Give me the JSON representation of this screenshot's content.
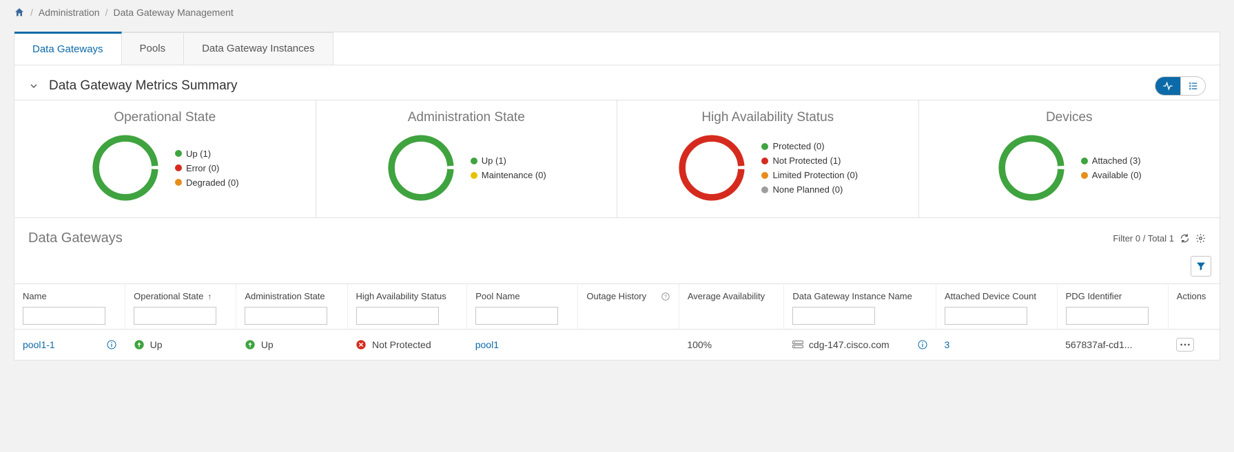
{
  "breadcrumb": {
    "items": [
      "Administration",
      "Data Gateway Management"
    ]
  },
  "tabs": {
    "items": [
      {
        "label": "Data Gateways",
        "active": true
      },
      {
        "label": "Pools",
        "active": false
      },
      {
        "label": "Data Gateway Instances",
        "active": false
      }
    ]
  },
  "summary": {
    "title": "Data Gateway Metrics Summary"
  },
  "chart_data": [
    {
      "type": "pie",
      "title": "Operational State",
      "series": [
        {
          "name": "Up",
          "value": 1,
          "color": "#3fa33f"
        },
        {
          "name": "Error",
          "value": 0,
          "color": "#d52b1e"
        },
        {
          "name": "Degraded",
          "value": 0,
          "color": "#e58e1a"
        }
      ],
      "legend": [
        "Up (1)",
        "Error (0)",
        "Degraded (0)"
      ]
    },
    {
      "type": "pie",
      "title": "Administration State",
      "series": [
        {
          "name": "Up",
          "value": 1,
          "color": "#3fa33f"
        },
        {
          "name": "Maintenance",
          "value": 0,
          "color": "#e6c200"
        }
      ],
      "legend": [
        "Up (1)",
        "Maintenance (0)"
      ]
    },
    {
      "type": "pie",
      "title": "High Availability Status",
      "series": [
        {
          "name": "Protected",
          "value": 0,
          "color": "#3fa33f"
        },
        {
          "name": "Not Protected",
          "value": 1,
          "color": "#d52b1e"
        },
        {
          "name": "Limited Protection",
          "value": 0,
          "color": "#e58e1a"
        },
        {
          "name": "None Planned",
          "value": 0,
          "color": "#9e9e9e"
        }
      ],
      "legend": [
        "Protected (0)",
        "Not Protected (1)",
        "Limited Protection (0)",
        "None Planned (0)"
      ]
    },
    {
      "type": "pie",
      "title": "Devices",
      "series": [
        {
          "name": "Attached",
          "value": 3,
          "color": "#3fa33f"
        },
        {
          "name": "Available",
          "value": 0,
          "color": "#e58e1a"
        }
      ],
      "legend": [
        "Attached (3)",
        "Available (0)"
      ]
    }
  ],
  "table": {
    "title": "Data Gateways",
    "filter_label": "Filter 0 / Total 1",
    "columns": [
      {
        "label": "Name"
      },
      {
        "label": "Operational State",
        "sort": "asc"
      },
      {
        "label": "Administration State"
      },
      {
        "label": "High Availability Status"
      },
      {
        "label": "Pool Name"
      },
      {
        "label": "Outage History",
        "help": true
      },
      {
        "label": "Average Availability"
      },
      {
        "label": "Data Gateway Instance Name"
      },
      {
        "label": "Attached Device Count"
      },
      {
        "label": "PDG Identifier"
      },
      {
        "label": "Actions"
      }
    ],
    "rows": [
      {
        "name": "pool1-1",
        "op_state": "Up",
        "admin_state": "Up",
        "ha_status": "Not Protected",
        "pool_name": "pool1",
        "outage_history": "",
        "avg_availability": "100%",
        "instance_name": "cdg-147.cisco.com",
        "attached_count": "3",
        "pdg_id": "567837af-cd1..."
      }
    ]
  }
}
